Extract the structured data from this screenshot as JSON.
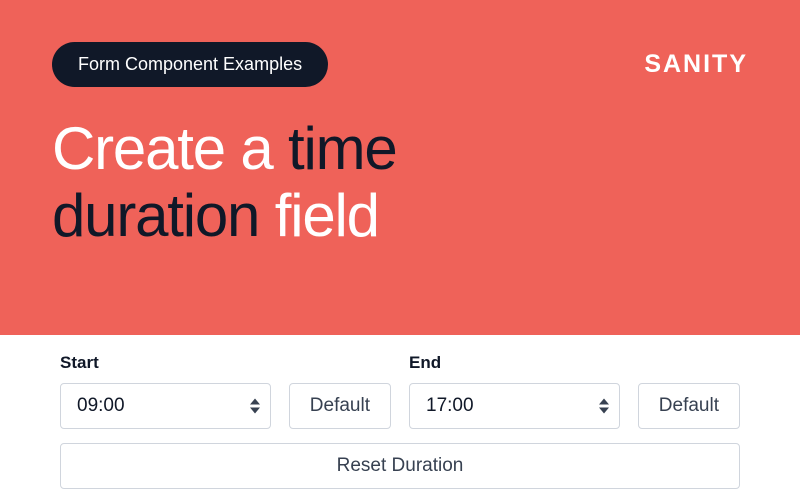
{
  "hero": {
    "pill": "Form Component Examples",
    "headline": {
      "w1": "Create a",
      "w2": "time",
      "w3": "duration",
      "w4": "field"
    }
  },
  "brand": {
    "name": "SANITY"
  },
  "form": {
    "start": {
      "label": "Start",
      "value": "09:00",
      "default_btn": "Default"
    },
    "end": {
      "label": "End",
      "value": "17:00",
      "default_btn": "Default"
    },
    "reset_btn": "Reset Duration"
  }
}
